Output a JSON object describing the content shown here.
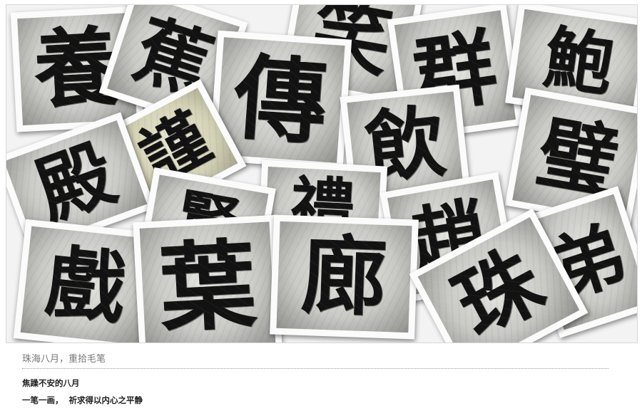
{
  "collage": {
    "tiles": [
      {
        "char": "養",
        "watermark": ""
      },
      {
        "char": "蕉",
        "watermark": ""
      },
      {
        "char": "傳",
        "watermark": ""
      },
      {
        "char": "笑",
        "watermark": ""
      },
      {
        "char": "群",
        "watermark": ""
      },
      {
        "char": "鮑",
        "watermark": ""
      },
      {
        "char": "謹",
        "watermark": ""
      },
      {
        "char": "飲",
        "watermark": ""
      },
      {
        "char": "璧",
        "watermark": ""
      },
      {
        "char": "殿",
        "watermark": ""
      },
      {
        "char": "賢",
        "watermark": ""
      },
      {
        "char": "禮",
        "watermark": ""
      },
      {
        "char": "趙",
        "watermark": ""
      },
      {
        "char": "弟",
        "watermark": ""
      },
      {
        "char": "戲",
        "watermark": ""
      },
      {
        "char": "葉",
        "watermark": ""
      },
      {
        "char": "廊",
        "watermark": ""
      },
      {
        "char": "珠",
        "watermark": ""
      }
    ]
  },
  "caption": {
    "title": "珠海八月，重拾毛笔",
    "line1": "焦躁不安的八月",
    "line2": "一笔一画，  祈求得以内心之平静"
  }
}
